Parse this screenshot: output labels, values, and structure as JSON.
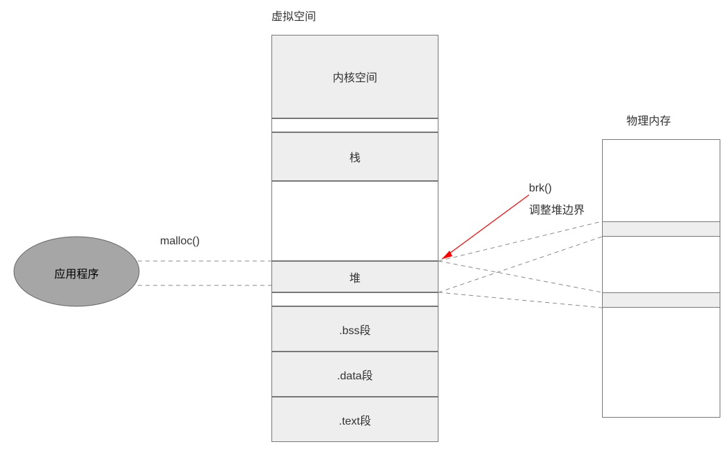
{
  "title_virtual_space": "虚拟空间",
  "title_physical_memory": "物理内存",
  "app_label": "应用程序",
  "malloc_label": "malloc()",
  "brk_label": "brk()",
  "brk_desc": "调整堆边界",
  "segments": {
    "kernel": "内核空间",
    "stack": "栈",
    "heap": "堆",
    "bss": ".bss段",
    "data": ".data段",
    "text": ".text段"
  }
}
